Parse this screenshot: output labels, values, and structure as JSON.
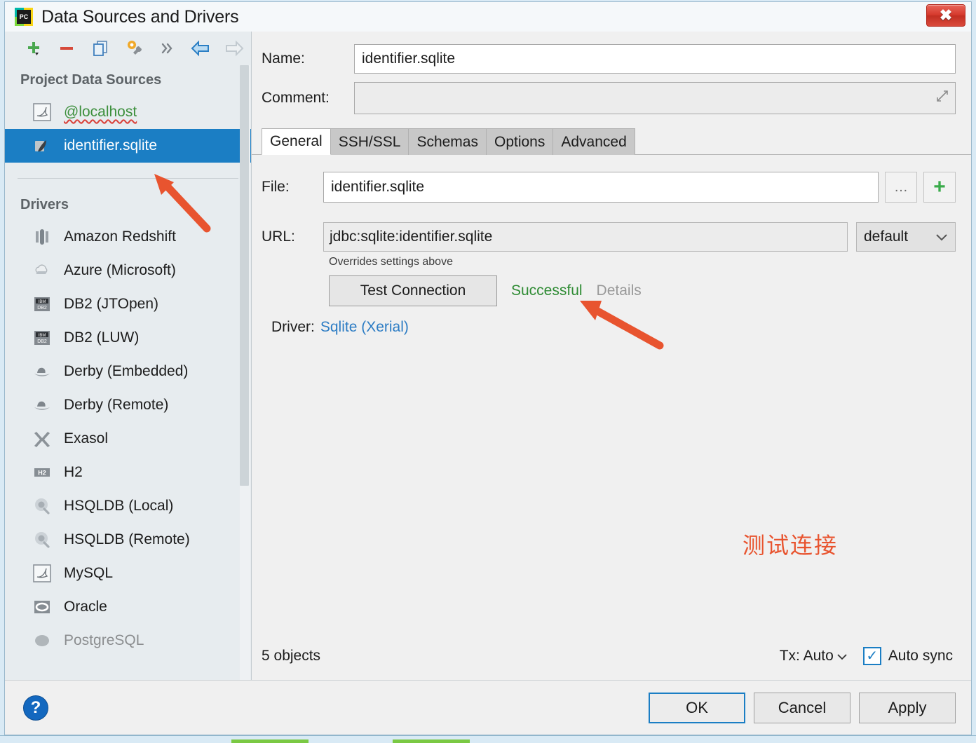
{
  "window": {
    "title": "Data Sources and Drivers",
    "logo_text": "PC",
    "close_label": "✖"
  },
  "toolbar": {
    "items": [
      {
        "name": "add",
        "icon": "plus-icon"
      },
      {
        "name": "remove",
        "icon": "minus-icon"
      },
      {
        "name": "duplicate",
        "icon": "copy-icon"
      },
      {
        "name": "properties",
        "icon": "wrench-gear-icon"
      },
      {
        "name": "more",
        "icon": "chevrons-right-icon"
      },
      {
        "name": "back",
        "icon": "arrow-left-icon"
      },
      {
        "name": "forward",
        "icon": "arrow-right-icon"
      }
    ]
  },
  "sidebar": {
    "project_section_title": "Project Data Sources",
    "data_sources": [
      {
        "label": "@localhost",
        "icon": "mysql-dolphin-icon",
        "selected": false
      },
      {
        "label": "identifier.sqlite",
        "icon": "sqlite-icon",
        "selected": true
      }
    ],
    "drivers_section_title": "Drivers",
    "drivers": [
      {
        "label": "Amazon Redshift",
        "icon": "redshift-icon"
      },
      {
        "label": "Azure (Microsoft)",
        "icon": "azure-cloud-icon"
      },
      {
        "label": "DB2 (JTOpen)",
        "icon": "db2-icon"
      },
      {
        "label": "DB2 (LUW)",
        "icon": "db2-icon"
      },
      {
        "label": "Derby (Embedded)",
        "icon": "derby-hat-icon"
      },
      {
        "label": "Derby (Remote)",
        "icon": "derby-hat-icon"
      },
      {
        "label": "Exasol",
        "icon": "exasol-x-icon"
      },
      {
        "label": "H2",
        "icon": "h2-icon"
      },
      {
        "label": "HSQLDB (Local)",
        "icon": "hsqldb-icon"
      },
      {
        "label": "HSQLDB (Remote)",
        "icon": "hsqldb-icon"
      },
      {
        "label": "MySQL",
        "icon": "mysql-dolphin-icon"
      },
      {
        "label": "Oracle",
        "icon": "oracle-icon"
      },
      {
        "label": "PostgreSQL",
        "icon": "postgresql-icon"
      }
    ]
  },
  "form": {
    "name_label": "Name:",
    "name_value": "identifier.sqlite",
    "comment_label": "Comment:",
    "comment_value": "",
    "comment_placeholder": ""
  },
  "tabs": [
    {
      "label": "General",
      "active": true
    },
    {
      "label": "SSH/SSL",
      "active": false
    },
    {
      "label": "Schemas",
      "active": false
    },
    {
      "label": "Options",
      "active": false
    },
    {
      "label": "Advanced",
      "active": false
    }
  ],
  "general": {
    "file_label": "File:",
    "file_value": "identifier.sqlite",
    "browse_label": "…",
    "add_label": "+",
    "url_label": "URL:",
    "url_value": "jdbc:sqlite:identifier.sqlite",
    "url_mode": "default",
    "url_hint": "Overrides settings above",
    "test_button": "Test Connection",
    "test_status": "Successful",
    "test_details": "Details",
    "driver_label": "Driver:",
    "driver_value": "Sqlite (Xerial)"
  },
  "annotation": {
    "note_cjk": "测试连接",
    "note_color": "#e8542f"
  },
  "status_bar": {
    "objects": "5 objects",
    "tx_label": "Tx: Auto",
    "auto_sync_label": "Auto sync",
    "auto_sync_checked": true
  },
  "footer": {
    "help_label": "?",
    "ok_label": "OK",
    "cancel_label": "Cancel",
    "apply_label": "Apply"
  },
  "colors": {
    "accent": "#1b7ec4",
    "success": "#2e8b33",
    "link": "#2c7cc4",
    "annotation": "#e8542f",
    "close": "#d6392c"
  }
}
